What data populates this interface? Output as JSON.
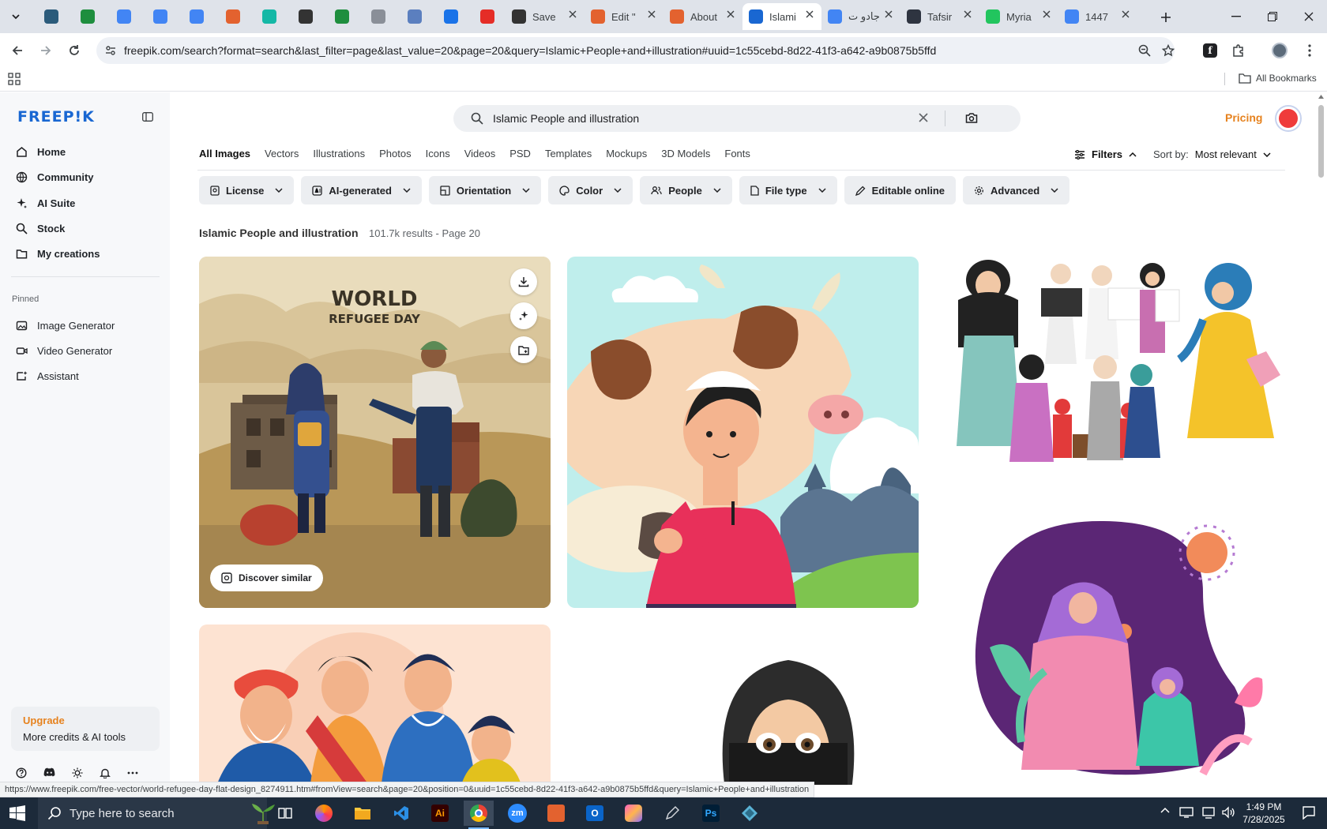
{
  "browser": {
    "tabs": [
      {
        "type": "pinned",
        "icon": "wordpress-icon",
        "color": "#2b5b7b"
      },
      {
        "type": "pinned",
        "icon": "sheets-icon",
        "color": "#1e8e3e"
      },
      {
        "type": "pinned",
        "icon": "docs-icon",
        "color": "#4285f4"
      },
      {
        "type": "pinned",
        "icon": "docs-icon",
        "color": "#4285f4"
      },
      {
        "type": "pinned",
        "icon": "docs-icon",
        "color": "#4285f4"
      },
      {
        "type": "pinned",
        "icon": "box-icon",
        "color": "#e3622f"
      },
      {
        "type": "pinned",
        "icon": "logo-icon",
        "color": "#14b8a6"
      },
      {
        "type": "pinned",
        "icon": "chatgpt-icon",
        "color": "#333333"
      },
      {
        "type": "pinned",
        "icon": "sheets-icon",
        "color": "#1e8e3e"
      },
      {
        "type": "pinned",
        "icon": "globe-icon",
        "color": "#8a8f98"
      },
      {
        "type": "pinned",
        "icon": "grid-icon",
        "color": "#5b7fbf"
      },
      {
        "type": "pinned",
        "icon": "forms-icon",
        "color": "#1a73e8"
      },
      {
        "type": "pinned",
        "icon": "youtube-icon",
        "color": "#e52d27"
      },
      {
        "type": "wide",
        "title": "Save",
        "icon": "chatgpt-icon",
        "color": "#333333"
      },
      {
        "type": "wide",
        "title": "Edit \"",
        "icon": "box-icon",
        "color": "#e3622f"
      },
      {
        "type": "wide",
        "title": "About",
        "icon": "box-icon",
        "color": "#e3622f"
      },
      {
        "type": "wide",
        "title": "Islami",
        "icon": "freepik-icon",
        "color": "#1967d2",
        "active": true
      },
      {
        "type": "wide",
        "title": "جادو ت",
        "icon": "google-icon",
        "color": "#4285f4"
      },
      {
        "type": "wide",
        "title": "Tafsir",
        "icon": "tafsir-icon",
        "color": "#2e3440"
      },
      {
        "type": "wide",
        "title": "Myria",
        "icon": "bolt-icon",
        "color": "#22c55e"
      },
      {
        "type": "wide",
        "title": "1447",
        "icon": "google-icon",
        "color": "#4285f4"
      }
    ],
    "url": "freepik.com/search?format=search&last_filter=page&last_value=20&page=20&query=Islamic+People+and+illustration#uuid=1c55cebd-8d22-41f3-a642-a9b0875b5ffd",
    "all_bookmarks": "All Bookmarks"
  },
  "sidebar": {
    "logo": "FREEP!K",
    "nav": [
      {
        "label": "Home",
        "icon": "home-icon"
      },
      {
        "label": "Community",
        "icon": "globe-icon"
      },
      {
        "label": "AI Suite",
        "icon": "sparkle-icon"
      },
      {
        "label": "Stock",
        "icon": "search-icon"
      },
      {
        "label": "My creations",
        "icon": "folder-icon"
      }
    ],
    "pinned_label": "Pinned",
    "pinned": [
      {
        "label": "Image Generator",
        "icon": "image-icon"
      },
      {
        "label": "Video Generator",
        "icon": "video-icon"
      },
      {
        "label": "Assistant",
        "icon": "assistant-icon"
      }
    ],
    "upgrade_title": "Upgrade",
    "upgrade_subtitle": "More credits & AI tools"
  },
  "header": {
    "search_value": "Islamic People and illustration",
    "pricing": "Pricing"
  },
  "categories": [
    {
      "label": "All Images",
      "active": true
    },
    {
      "label": "Vectors"
    },
    {
      "label": "Illustrations"
    },
    {
      "label": "Photos"
    },
    {
      "label": "Icons"
    },
    {
      "label": "Videos"
    },
    {
      "label": "PSD"
    },
    {
      "label": "Templates"
    },
    {
      "label": "Mockups"
    },
    {
      "label": "3D Models"
    },
    {
      "label": "Fonts"
    }
  ],
  "filters_label": "Filters",
  "sort": {
    "label": "Sort by:",
    "value": "Most relevant"
  },
  "chips": [
    {
      "label": "License",
      "icon": "license-icon"
    },
    {
      "label": "AI-generated",
      "icon": "ai-icon"
    },
    {
      "label": "Orientation",
      "icon": "orientation-icon"
    },
    {
      "label": "Color",
      "icon": "palette-icon"
    },
    {
      "label": "People",
      "icon": "people-icon"
    },
    {
      "label": "File type",
      "icon": "file-icon"
    },
    {
      "label": "Editable online",
      "icon": "pen-icon",
      "no_chevron": true
    },
    {
      "label": "Advanced",
      "icon": "gear-icon"
    }
  ],
  "results": {
    "title": "Islamic People and illustration",
    "count": "101.7k results - Page 20"
  },
  "card1": {
    "heading1": "WORLD",
    "heading2": "REFUGEE DAY"
  },
  "discover_similar": "Discover similar",
  "status_url": "https://www.freepik.com/free-vector/world-refugee-day-flat-design_8274911.htm#fromView=search&page=20&position=0&uuid=1c55cebd-8d22-41f3-a642-a9b0875b5ffd&query=Islamic+People+and+illustration",
  "taskbar": {
    "search_placeholder": "Type here to search",
    "time": "1:49 PM",
    "date": "7/28/2025"
  },
  "colors": {
    "brand": "#1967d2",
    "pricing": "#e6821e",
    "taskbar": "#1c2a3a"
  }
}
